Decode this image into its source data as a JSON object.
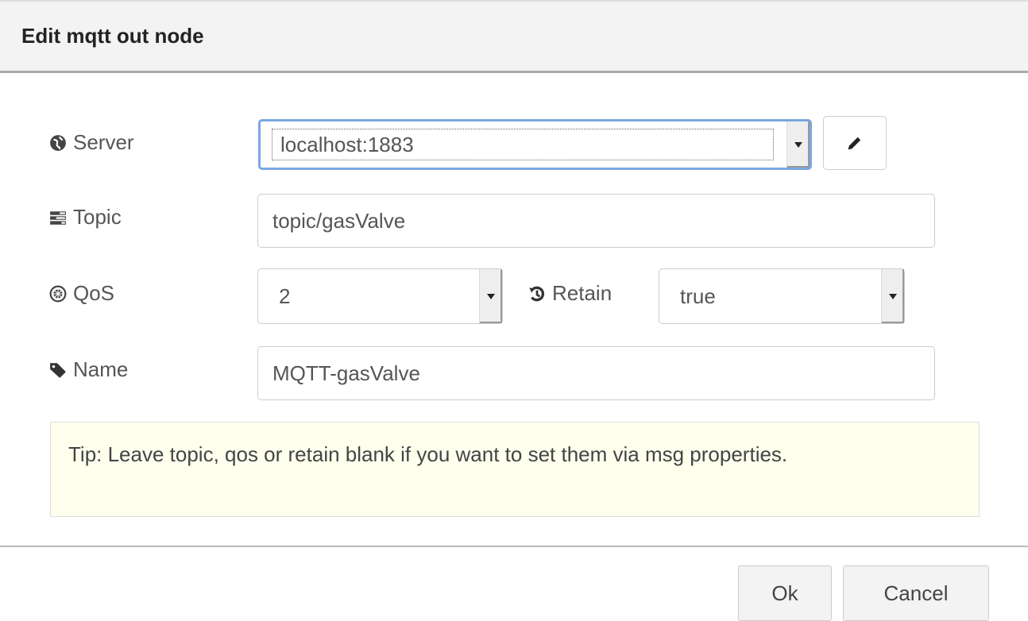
{
  "dialog": {
    "title": "Edit mqtt out node"
  },
  "form": {
    "server": {
      "label": "Server",
      "value": "localhost:1883",
      "icon": "globe-icon",
      "edit_icon": "pencil-icon"
    },
    "topic": {
      "label": "Topic",
      "value": "topic/gasValve",
      "icon": "tasks-icon"
    },
    "qos": {
      "label": "QoS",
      "value": "2",
      "icon": "empire-icon"
    },
    "retain": {
      "label": "Retain",
      "value": "true",
      "icon": "history-icon"
    },
    "name": {
      "label": "Name",
      "value": "MQTT-gasValve",
      "icon": "tag-icon"
    }
  },
  "tip": "Tip: Leave topic, qos or retain blank if you want to set them via msg properties.",
  "footer": {
    "ok_label": "Ok",
    "cancel_label": "Cancel"
  },
  "colors": {
    "focus": "#7aa7e0",
    "tip_bg": "#ffffee",
    "header_bg": "#f3f3f3"
  }
}
